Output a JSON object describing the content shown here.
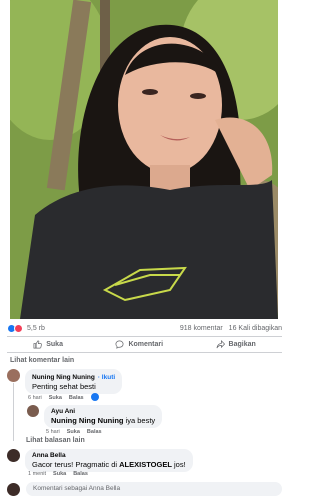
{
  "post": {
    "photo_alt": "woman selfie",
    "reaction_count": "5,5 rb",
    "comment_count": "918 komentar",
    "share_count": "16 Kali dibagikan"
  },
  "actions": {
    "like": "Suka",
    "comment": "Komentari",
    "share": "Bagikan"
  },
  "more_comments": "Lihat komentar lain",
  "comments": [
    {
      "name": "Nuning Ning Nuning",
      "follow": "· Ikuti",
      "text": "Penting sehat besti",
      "time": "6 hari",
      "like": "Suka",
      "reply": "Balas"
    },
    {
      "name": "Ayu Ani",
      "mention": "Nuning Ning Nuning",
      "text": " iya besty",
      "time": "5 hari",
      "like": "Suka",
      "reply": "Balas"
    },
    {
      "name": "Anna Bella",
      "text_prefix": "Gacor terus! Pragmatic di ",
      "text_bold": "ALEXISTOGEL",
      "text_suffix": " jos!",
      "time": "1 menit",
      "like": "Suka",
      "reply": "Balas"
    }
  ],
  "other_replies": "Lihat balasan lain",
  "compose": {
    "placeholder": "Komentari sebagai Anna Bella"
  },
  "colors": {
    "accent": "#1877f2",
    "love": "#f33e58",
    "bubble": "#f0f2f5",
    "muted": "#65676b"
  }
}
